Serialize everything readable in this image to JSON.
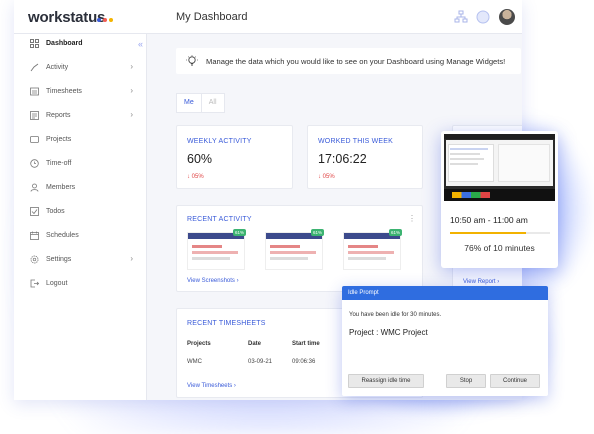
{
  "brand": {
    "logo_text": "workstatus",
    "dot_colors": [
      "#3a5bd9",
      "#f25c54",
      "#f4b400"
    ]
  },
  "header": {
    "title": "My Dashboard"
  },
  "sidebar": {
    "items": [
      {
        "label": "Dashboard",
        "icon": "grid-icon"
      },
      {
        "label": "Activity",
        "icon": "activity-icon"
      },
      {
        "label": "Timesheets",
        "icon": "timesheets-icon"
      },
      {
        "label": "Reports",
        "icon": "reports-icon"
      },
      {
        "label": "Projects",
        "icon": "projects-icon"
      },
      {
        "label": "Time-off",
        "icon": "clock-icon"
      },
      {
        "label": "Members",
        "icon": "user-icon"
      },
      {
        "label": "Todos",
        "icon": "todos-icon"
      },
      {
        "label": "Schedules",
        "icon": "calendar-icon"
      },
      {
        "label": "Settings",
        "icon": "gear-icon"
      },
      {
        "label": "Logout",
        "icon": "logout-icon"
      }
    ]
  },
  "banner": {
    "text": "Manage the data which you would like to see on your Dashboard using Manage Widgets!"
  },
  "tabs": [
    "Me",
    "All"
  ],
  "weekly_activity": {
    "title": "WEEKLY ACTIVITY",
    "value": "60%",
    "delta": "05%"
  },
  "worked_this_week": {
    "title": "WORKED THIS WEEK",
    "value": "17:06:22",
    "delta": "05%"
  },
  "recent_activity": {
    "title": "RECENT ACTIVITY",
    "badges": [
      "61%",
      "61%",
      "61%"
    ],
    "link": "View Screenshots"
  },
  "recent_timesheets": {
    "title": "RECENT TIMESHEETS",
    "columns": [
      "Projects",
      "Date",
      "Start time"
    ],
    "row": [
      "WMC",
      "03-09-21",
      "09:06:36"
    ],
    "link": "View Timesheets"
  },
  "preview": {
    "time_range": "10:50 am - 11:00 am",
    "progress": 0.76,
    "percent_label": "76% of 10 minutes",
    "link": "View Report"
  },
  "idle_prompt": {
    "title": "Idle Prompt",
    "message": "You have been idle for 30 minutes.",
    "project": "Project : WMC Project",
    "buttons": {
      "reassign": "Reassign idle time",
      "stop": "Stop",
      "continue": "Continue"
    }
  }
}
